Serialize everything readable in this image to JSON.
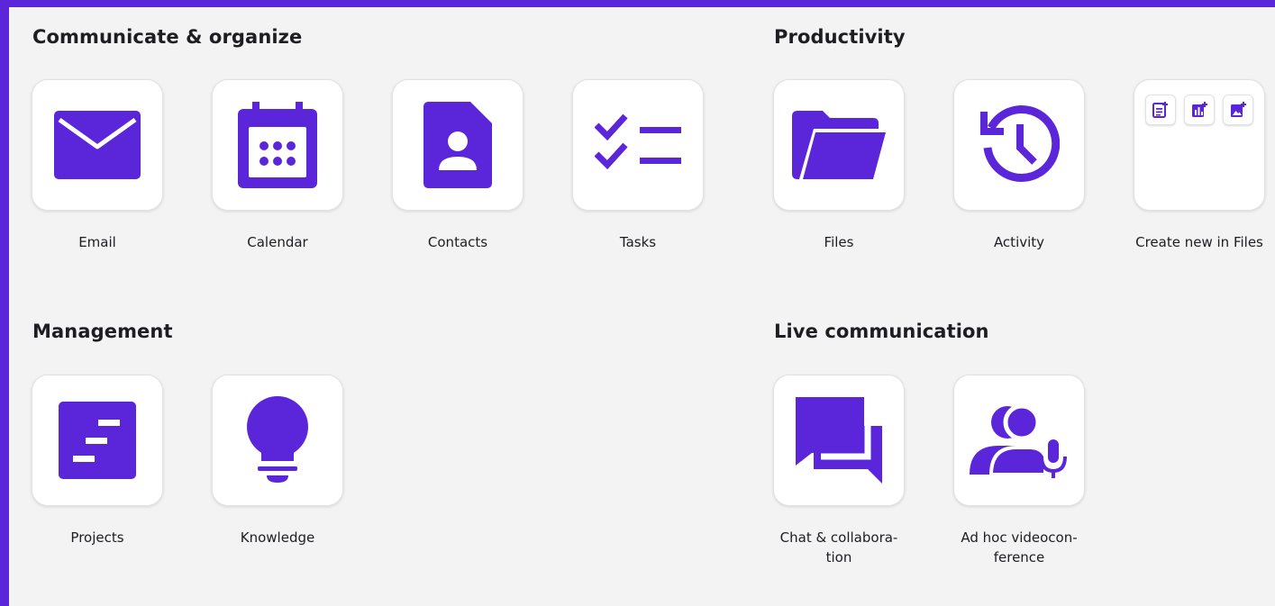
{
  "colors": {
    "accent": "#5b26d9",
    "background": "#f3f3f4",
    "card": "#ffffff"
  },
  "sections": {
    "communicate": {
      "title": "Communicate & organize",
      "apps": [
        {
          "label": "Email",
          "icon": "envelope-icon"
        },
        {
          "label": "Calendar",
          "icon": "calendar-icon"
        },
        {
          "label": "Contacts",
          "icon": "contact-card-icon"
        },
        {
          "label": "Tasks",
          "icon": "checklist-icon"
        }
      ]
    },
    "productivity": {
      "title": "Productivity",
      "apps": [
        {
          "label": "Files",
          "icon": "folder-icon"
        },
        {
          "label": "Activity",
          "icon": "history-clock-icon"
        },
        {
          "label": "Create new in Files",
          "icon": "create-new-icons",
          "mini_icons": [
            "new-document-icon",
            "new-spreadsheet-icon",
            "new-image-icon"
          ]
        }
      ]
    },
    "management": {
      "title": "Management",
      "apps": [
        {
          "label": "Projects",
          "icon": "gantt-board-icon"
        },
        {
          "label": "Knowledge",
          "icon": "lightbulb-icon"
        }
      ]
    },
    "live": {
      "title": "Live communication",
      "apps": [
        {
          "label": "Chat & collabora-\ntion",
          "icon": "chat-bubbles-icon"
        },
        {
          "label": "Ad hoc videocon-\nference",
          "icon": "users-microphone-icon"
        }
      ]
    }
  }
}
